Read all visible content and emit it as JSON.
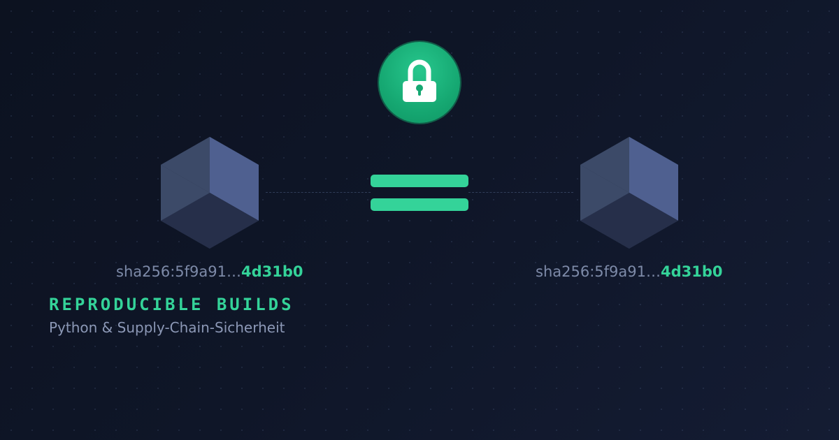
{
  "lock_icon": "lock-icon",
  "left_hash": {
    "prefix": "sha256:5f9a91…",
    "suffix": "4d31b0"
  },
  "right_hash": {
    "prefix": "sha256:5f9a91…",
    "suffix": "4d31b0"
  },
  "title": "REPRODUCIBLE BUILDS",
  "subtitle": "Python & Supply-Chain-Sicherheit",
  "colors": {
    "accent": "#34d399",
    "lock_green": "#16a872",
    "background": "#0f1628",
    "cube_top_left": "#3c4a68",
    "cube_top_right": "#4f6090",
    "cube_bottom": "#262f4a",
    "muted_text": "#7d8aa8"
  }
}
